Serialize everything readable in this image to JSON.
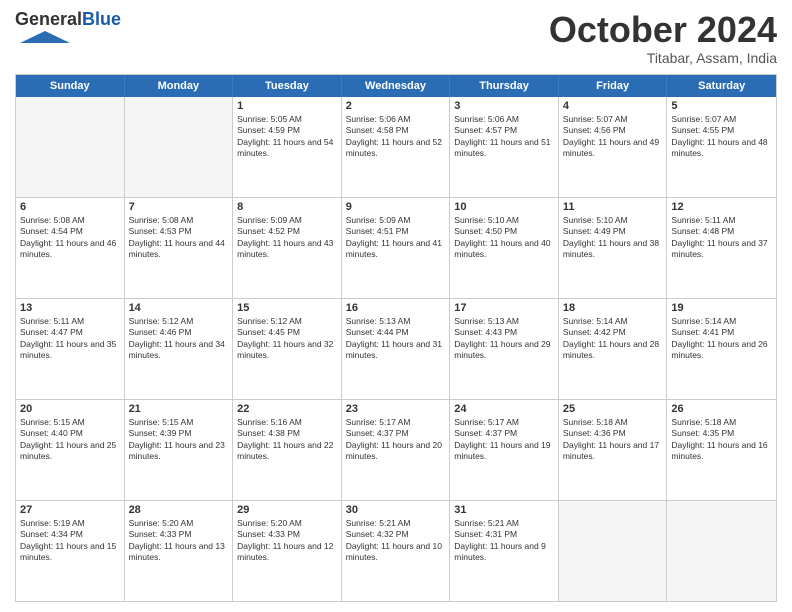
{
  "logo": {
    "general": "General",
    "blue": "Blue"
  },
  "header": {
    "month": "October 2024",
    "location": "Titabar, Assam, India"
  },
  "dayNames": [
    "Sunday",
    "Monday",
    "Tuesday",
    "Wednesday",
    "Thursday",
    "Friday",
    "Saturday"
  ],
  "weeks": [
    [
      {
        "num": "",
        "sunrise": "",
        "sunset": "",
        "daylight": "",
        "empty": true
      },
      {
        "num": "",
        "sunrise": "",
        "sunset": "",
        "daylight": "",
        "empty": true
      },
      {
        "num": "1",
        "sunrise": "Sunrise: 5:05 AM",
        "sunset": "Sunset: 4:59 PM",
        "daylight": "Daylight: 11 hours and 54 minutes.",
        "empty": false
      },
      {
        "num": "2",
        "sunrise": "Sunrise: 5:06 AM",
        "sunset": "Sunset: 4:58 PM",
        "daylight": "Daylight: 11 hours and 52 minutes.",
        "empty": false
      },
      {
        "num": "3",
        "sunrise": "Sunrise: 5:06 AM",
        "sunset": "Sunset: 4:57 PM",
        "daylight": "Daylight: 11 hours and 51 minutes.",
        "empty": false
      },
      {
        "num": "4",
        "sunrise": "Sunrise: 5:07 AM",
        "sunset": "Sunset: 4:56 PM",
        "daylight": "Daylight: 11 hours and 49 minutes.",
        "empty": false
      },
      {
        "num": "5",
        "sunrise": "Sunrise: 5:07 AM",
        "sunset": "Sunset: 4:55 PM",
        "daylight": "Daylight: 11 hours and 48 minutes.",
        "empty": false
      }
    ],
    [
      {
        "num": "6",
        "sunrise": "Sunrise: 5:08 AM",
        "sunset": "Sunset: 4:54 PM",
        "daylight": "Daylight: 11 hours and 46 minutes.",
        "empty": false
      },
      {
        "num": "7",
        "sunrise": "Sunrise: 5:08 AM",
        "sunset": "Sunset: 4:53 PM",
        "daylight": "Daylight: 11 hours and 44 minutes.",
        "empty": false
      },
      {
        "num": "8",
        "sunrise": "Sunrise: 5:09 AM",
        "sunset": "Sunset: 4:52 PM",
        "daylight": "Daylight: 11 hours and 43 minutes.",
        "empty": false
      },
      {
        "num": "9",
        "sunrise": "Sunrise: 5:09 AM",
        "sunset": "Sunset: 4:51 PM",
        "daylight": "Daylight: 11 hours and 41 minutes.",
        "empty": false
      },
      {
        "num": "10",
        "sunrise": "Sunrise: 5:10 AM",
        "sunset": "Sunset: 4:50 PM",
        "daylight": "Daylight: 11 hours and 40 minutes.",
        "empty": false
      },
      {
        "num": "11",
        "sunrise": "Sunrise: 5:10 AM",
        "sunset": "Sunset: 4:49 PM",
        "daylight": "Daylight: 11 hours and 38 minutes.",
        "empty": false
      },
      {
        "num": "12",
        "sunrise": "Sunrise: 5:11 AM",
        "sunset": "Sunset: 4:48 PM",
        "daylight": "Daylight: 11 hours and 37 minutes.",
        "empty": false
      }
    ],
    [
      {
        "num": "13",
        "sunrise": "Sunrise: 5:11 AM",
        "sunset": "Sunset: 4:47 PM",
        "daylight": "Daylight: 11 hours and 35 minutes.",
        "empty": false
      },
      {
        "num": "14",
        "sunrise": "Sunrise: 5:12 AM",
        "sunset": "Sunset: 4:46 PM",
        "daylight": "Daylight: 11 hours and 34 minutes.",
        "empty": false
      },
      {
        "num": "15",
        "sunrise": "Sunrise: 5:12 AM",
        "sunset": "Sunset: 4:45 PM",
        "daylight": "Daylight: 11 hours and 32 minutes.",
        "empty": false
      },
      {
        "num": "16",
        "sunrise": "Sunrise: 5:13 AM",
        "sunset": "Sunset: 4:44 PM",
        "daylight": "Daylight: 11 hours and 31 minutes.",
        "empty": false
      },
      {
        "num": "17",
        "sunrise": "Sunrise: 5:13 AM",
        "sunset": "Sunset: 4:43 PM",
        "daylight": "Daylight: 11 hours and 29 minutes.",
        "empty": false
      },
      {
        "num": "18",
        "sunrise": "Sunrise: 5:14 AM",
        "sunset": "Sunset: 4:42 PM",
        "daylight": "Daylight: 11 hours and 28 minutes.",
        "empty": false
      },
      {
        "num": "19",
        "sunrise": "Sunrise: 5:14 AM",
        "sunset": "Sunset: 4:41 PM",
        "daylight": "Daylight: 11 hours and 26 minutes.",
        "empty": false
      }
    ],
    [
      {
        "num": "20",
        "sunrise": "Sunrise: 5:15 AM",
        "sunset": "Sunset: 4:40 PM",
        "daylight": "Daylight: 11 hours and 25 minutes.",
        "empty": false
      },
      {
        "num": "21",
        "sunrise": "Sunrise: 5:15 AM",
        "sunset": "Sunset: 4:39 PM",
        "daylight": "Daylight: 11 hours and 23 minutes.",
        "empty": false
      },
      {
        "num": "22",
        "sunrise": "Sunrise: 5:16 AM",
        "sunset": "Sunset: 4:38 PM",
        "daylight": "Daylight: 11 hours and 22 minutes.",
        "empty": false
      },
      {
        "num": "23",
        "sunrise": "Sunrise: 5:17 AM",
        "sunset": "Sunset: 4:37 PM",
        "daylight": "Daylight: 11 hours and 20 minutes.",
        "empty": false
      },
      {
        "num": "24",
        "sunrise": "Sunrise: 5:17 AM",
        "sunset": "Sunset: 4:37 PM",
        "daylight": "Daylight: 11 hours and 19 minutes.",
        "empty": false
      },
      {
        "num": "25",
        "sunrise": "Sunrise: 5:18 AM",
        "sunset": "Sunset: 4:36 PM",
        "daylight": "Daylight: 11 hours and 17 minutes.",
        "empty": false
      },
      {
        "num": "26",
        "sunrise": "Sunrise: 5:18 AM",
        "sunset": "Sunset: 4:35 PM",
        "daylight": "Daylight: 11 hours and 16 minutes.",
        "empty": false
      }
    ],
    [
      {
        "num": "27",
        "sunrise": "Sunrise: 5:19 AM",
        "sunset": "Sunset: 4:34 PM",
        "daylight": "Daylight: 11 hours and 15 minutes.",
        "empty": false
      },
      {
        "num": "28",
        "sunrise": "Sunrise: 5:20 AM",
        "sunset": "Sunset: 4:33 PM",
        "daylight": "Daylight: 11 hours and 13 minutes.",
        "empty": false
      },
      {
        "num": "29",
        "sunrise": "Sunrise: 5:20 AM",
        "sunset": "Sunset: 4:33 PM",
        "daylight": "Daylight: 11 hours and 12 minutes.",
        "empty": false
      },
      {
        "num": "30",
        "sunrise": "Sunrise: 5:21 AM",
        "sunset": "Sunset: 4:32 PM",
        "daylight": "Daylight: 11 hours and 10 minutes.",
        "empty": false
      },
      {
        "num": "31",
        "sunrise": "Sunrise: 5:21 AM",
        "sunset": "Sunset: 4:31 PM",
        "daylight": "Daylight: 11 hours and 9 minutes.",
        "empty": false
      },
      {
        "num": "",
        "sunrise": "",
        "sunset": "",
        "daylight": "",
        "empty": true
      },
      {
        "num": "",
        "sunrise": "",
        "sunset": "",
        "daylight": "",
        "empty": true
      }
    ]
  ]
}
